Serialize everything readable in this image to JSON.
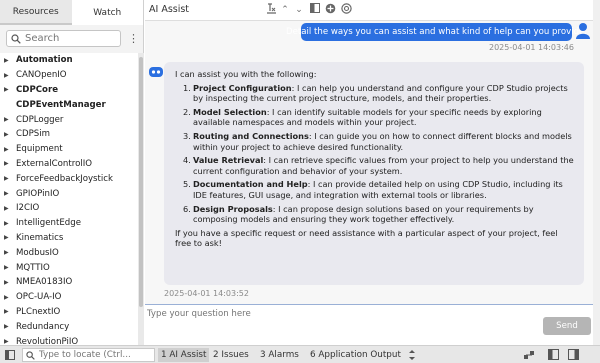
{
  "left_panel": {
    "tabs": [
      {
        "label": "Resources",
        "active": true
      },
      {
        "label": "Watch",
        "active": false
      }
    ],
    "search": {
      "placeholder": "Search"
    },
    "tree": [
      {
        "label": "Automation",
        "bold": true,
        "arrow": true
      },
      {
        "label": "CANOpenIO",
        "bold": false,
        "arrow": true
      },
      {
        "label": "CDPCore",
        "bold": true,
        "arrow": true
      },
      {
        "label": "CDPEventManager",
        "bold": true,
        "arrow": false
      },
      {
        "label": "CDPLogger",
        "bold": false,
        "arrow": true
      },
      {
        "label": "CDPSim",
        "bold": false,
        "arrow": true
      },
      {
        "label": "Equipment",
        "bold": false,
        "arrow": true
      },
      {
        "label": "ExternalControlIO",
        "bold": false,
        "arrow": true
      },
      {
        "label": "ForceFeedbackJoystick",
        "bold": false,
        "arrow": true
      },
      {
        "label": "GPIOPinIO",
        "bold": false,
        "arrow": true
      },
      {
        "label": "I2CIO",
        "bold": false,
        "arrow": true
      },
      {
        "label": "IntelligentEdge",
        "bold": false,
        "arrow": true
      },
      {
        "label": "Kinematics",
        "bold": false,
        "arrow": true
      },
      {
        "label": "ModbusIO",
        "bold": false,
        "arrow": true
      },
      {
        "label": "MQTTIO",
        "bold": false,
        "arrow": true
      },
      {
        "label": "NMEA0183IO",
        "bold": false,
        "arrow": true
      },
      {
        "label": "OPC-UA-IO",
        "bold": false,
        "arrow": true
      },
      {
        "label": "PLCnextIO",
        "bold": false,
        "arrow": true
      },
      {
        "label": "Redundancy",
        "bold": false,
        "arrow": true
      },
      {
        "label": "RevolutionPiIO",
        "bold": false,
        "arrow": true
      }
    ]
  },
  "ai_assist": {
    "title": "AI Assist",
    "user_message": "Detail the ways you can assist and what kind of help can you provide.",
    "user_time": "2025-04-01 14:03:46",
    "bot_intro": "I can assist you with the following:",
    "bot_items": [
      {
        "num": "1.",
        "title": "Project Configuration",
        "text": ": I can help you understand and configure your CDP Studio projects by inspecting the current project structure, models, and their properties."
      },
      {
        "num": "2.",
        "title": "Model Selection",
        "text": ": I can identify suitable models for your specific needs by exploring available namespaces and models within your project."
      },
      {
        "num": "3.",
        "title": "Routing and Connections",
        "text": ": I can guide you on how to connect different blocks and models within your project to achieve desired functionality."
      },
      {
        "num": "4.",
        "title": "Value Retrieval",
        "text": ": I can retrieve specific values from your project to help you understand the current configuration and behavior of your system."
      },
      {
        "num": "5.",
        "title": "Documentation and Help",
        "text": ": I can provide detailed help on using CDP Studio, including its IDE features, GUI usage, and integration with external tools or libraries."
      },
      {
        "num": "6.",
        "title": "Design Proposals",
        "text": ": I can propose design solutions based on your requirements by composing models and ensuring they work together effectively."
      }
    ],
    "bot_outro": "If you have a specific request or need assistance with a particular aspect of your project, feel free to ask!",
    "bot_time": "2025-04-01 14:03:52",
    "input_placeholder": "Type your question here",
    "send_label": "Send",
    "colors": {
      "user_bubble": "#2b6fe0",
      "bot_bubble": "#e9e9ef",
      "send_button": "#b5b5b5"
    }
  },
  "statusbar": {
    "locate_placeholder": "Type to locate (Ctrl...",
    "tabs": [
      {
        "label": "1 AI Assist",
        "active": true
      },
      {
        "label": "2 Issues",
        "active": false
      },
      {
        "label": "3 Alarms",
        "active": false
      },
      {
        "label": "6 Application Output",
        "active": false
      }
    ]
  }
}
